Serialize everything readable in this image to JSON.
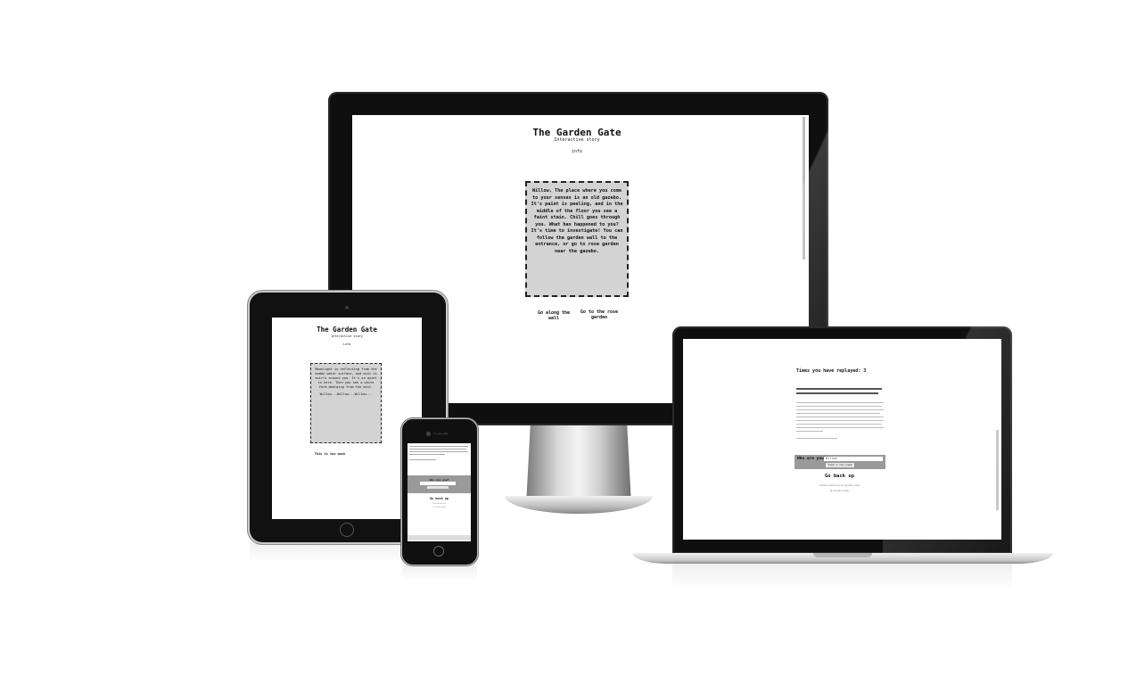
{
  "desktop": {
    "title": "The Garden Gate",
    "subtitle": "Interactive story",
    "info_link": "info",
    "story": "Willow, The place where you come to your senses is an old gazebo. It's paint is peeling, and in the middle of the floor you see a faint stain. Chill goes through you. What has happened to you? It's time to investigate! You can follow the garden wall to the entrance, or go to rose garden near the gazebo.",
    "choice_1": "Go along the wall",
    "choice_2": "Go to the rose garden"
  },
  "tablet": {
    "title": "The Garden Gate",
    "subtitle": "Interactive story",
    "info_link": "info",
    "story": "Moonlight is reflecting from the muddy water surface, and mist is swirls around you. It's so quiet in here. Then you see a white form emerging from the mist.",
    "story_call": "Willow...Willow...Willow...",
    "choice_1": "This is too much"
  },
  "phone": {
    "address": "ci-sg.edu",
    "input_label": "Who are you?",
    "back_link": "Go back up",
    "footer_1": "Created with love",
    "footer_2": "@ Garden Gate"
  },
  "laptop": {
    "replay_label": "Times you have replayed: 3",
    "input_label": "Who are you?:",
    "input_value": "Willow",
    "submit_label": "Take a new name",
    "back_link": "Go back up",
    "footer_1": "Created with love by Garden Gate",
    "footer_2": "@ Garden Gate"
  }
}
